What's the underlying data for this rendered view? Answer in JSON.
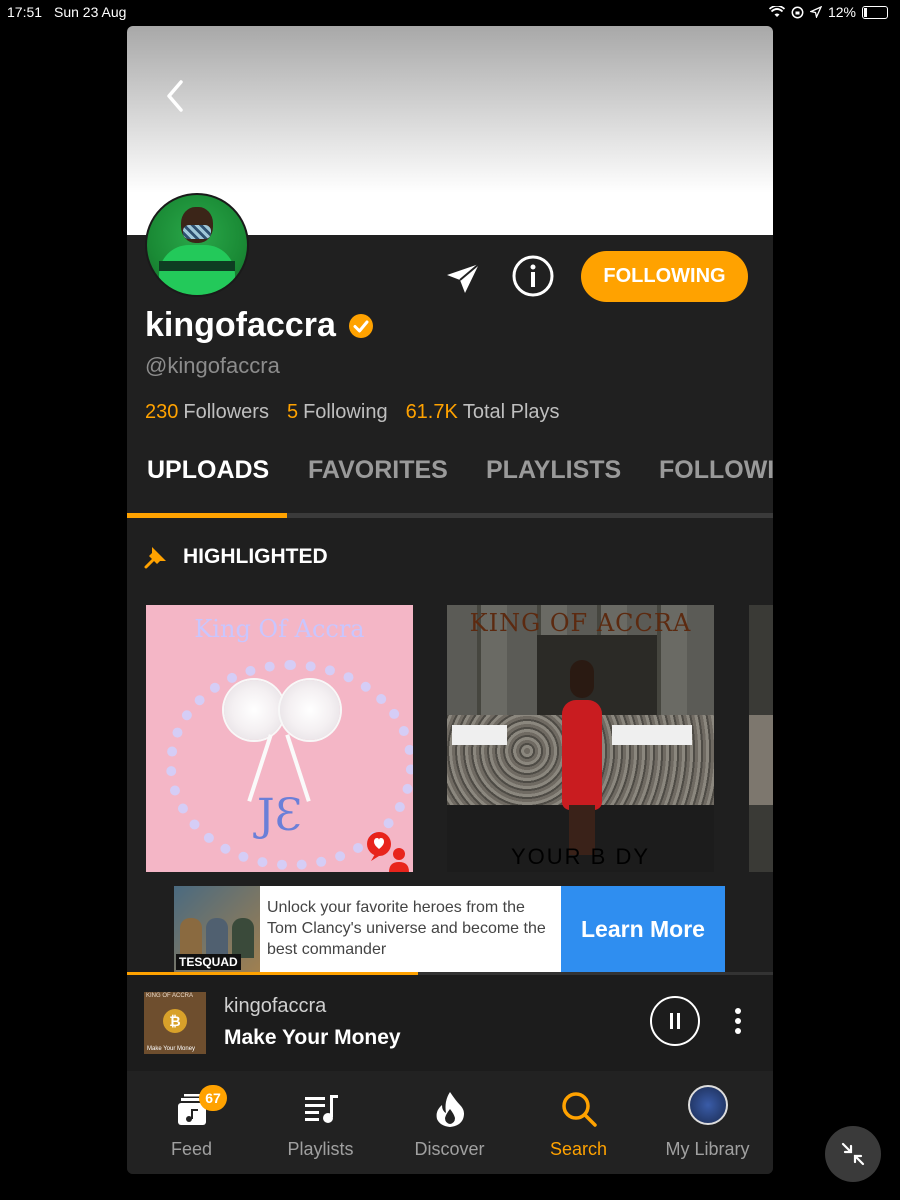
{
  "status_bar": {
    "time": "17:51",
    "date": "Sun 23 Aug",
    "battery": "12%"
  },
  "profile": {
    "display_name": "kingofaccra",
    "handle": "@kingofaccra",
    "verified": true,
    "follow_label": "FOLLOWING",
    "stats": [
      {
        "value": "230",
        "label": "Followers"
      },
      {
        "value": "5",
        "label": "Following"
      },
      {
        "value": "61.7K",
        "label": "Total Plays"
      }
    ]
  },
  "tabs": [
    {
      "label": "UPLOADS",
      "active": true
    },
    {
      "label": "FAVORITES",
      "active": false
    },
    {
      "label": "PLAYLISTS",
      "active": false
    },
    {
      "label": "FOLLOWI",
      "active": false
    }
  ],
  "highlighted": {
    "heading": "HIGHLIGHTED",
    "cards": [
      {
        "title": "King Of Accra",
        "subtitle": "JƐ"
      },
      {
        "title": "KING OF ACCRA",
        "subtitle": "YOUR B  DY"
      }
    ]
  },
  "ad": {
    "text": "Unlock your favorite heroes from the Tom Clancy's universe and become the best commander",
    "cta": "Learn More",
    "logo": "ТЕSQUAD"
  },
  "now_playing": {
    "artist": "kingofaccra",
    "title": "Make Your Money",
    "art_top_text": "KING OF ACCRA",
    "art_bottom_text": "Make Your Money",
    "progress": 0.45
  },
  "nav": [
    {
      "label": "Feed",
      "icon": "feed-icon",
      "badge": "67",
      "active": false
    },
    {
      "label": "Playlists",
      "icon": "playlists-icon",
      "active": false
    },
    {
      "label": "Discover",
      "icon": "fire-icon",
      "active": false
    },
    {
      "label": "Search",
      "icon": "search-icon",
      "active": true
    },
    {
      "label": "My Library",
      "icon": "avatar-icon",
      "active": false
    }
  ],
  "colors": {
    "accent": "#ffa200",
    "background": "#1f1f1f",
    "ad_cta": "#2f8ef0"
  }
}
